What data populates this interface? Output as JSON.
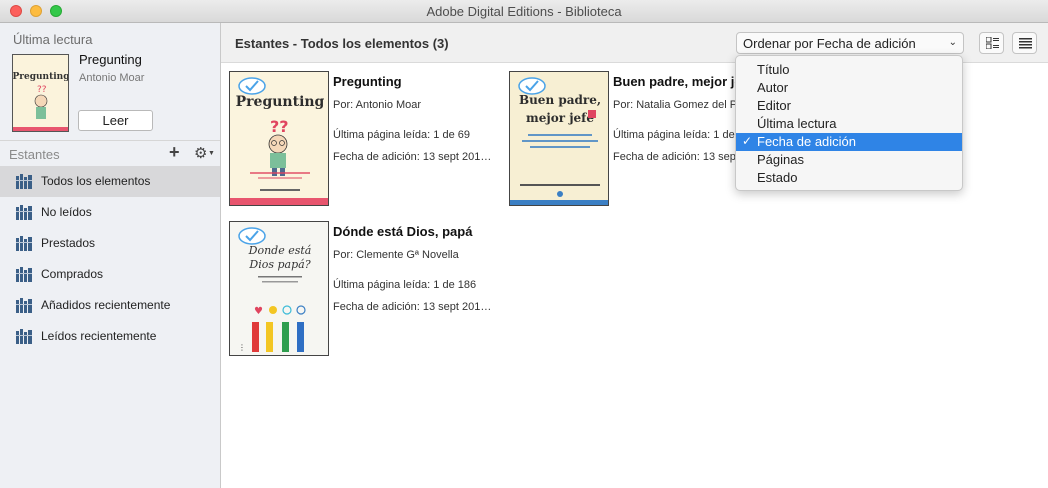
{
  "window": {
    "title": "Adobe Digital Editions - Biblioteca"
  },
  "sidebar": {
    "last_read_heading": "Última lectura",
    "last_read_book": {
      "title": "Pregunting",
      "author": "Antonio Moar"
    },
    "read_button": "Leer",
    "shelves_label": "Estantes",
    "shelves": [
      {
        "label": "Todos los elementos",
        "selected": true
      },
      {
        "label": "No leídos",
        "selected": false
      },
      {
        "label": "Prestados",
        "selected": false
      },
      {
        "label": "Comprados",
        "selected": false
      },
      {
        "label": "Añadidos recientemente",
        "selected": false
      },
      {
        "label": "Leídos recientemente",
        "selected": false
      }
    ]
  },
  "main": {
    "title": "Estantes - Todos los elementos (3)",
    "sort": {
      "selected": "Ordenar por Fecha de adición",
      "options": [
        "Título",
        "Autor",
        "Editor",
        "Última lectura",
        "Fecha de adición",
        "Páginas",
        "Estado"
      ],
      "checked_option": "Fecha de adición"
    },
    "books": [
      {
        "title": "Pregunting",
        "author": "Por: Antonio Moar",
        "last_page": "Última página leída: 1 de 69",
        "added": "Fecha de adición: 13 sept 201…",
        "cover_title": "Pregunting"
      },
      {
        "title": "Buen padre, mejor je",
        "author": "Por: Natalia Gomez del Po",
        "last_page": "Última página leída: 1 de",
        "added": "Fecha de adición: 13 sep",
        "cover_title": "Buen padre, mejor jefe"
      },
      {
        "title": "Dónde está Dios, papá",
        "author": "Por: Clemente Gª Novella",
        "last_page": "Última página leída: 1 de 186",
        "added": "Fecha de adición: 13 sept 201…",
        "cover_title": "Donde está Dios papá?"
      }
    ]
  },
  "colors": {
    "selection_blue": "#2f84e6",
    "sidebar_bg": "#eef0f4",
    "selected_shelf_bg": "#d8d8da",
    "check_badge": "#4aa3e8"
  },
  "icons": {
    "add_shelf": "plus-icon",
    "shelf_settings": "gear-icon",
    "shelf": "bookshelf-icon",
    "view_grid": "grid-view-icon",
    "view_list": "list-view-icon",
    "sort_chevron": "chevron-down-icon",
    "badge": "checkmark-badge-icon"
  }
}
